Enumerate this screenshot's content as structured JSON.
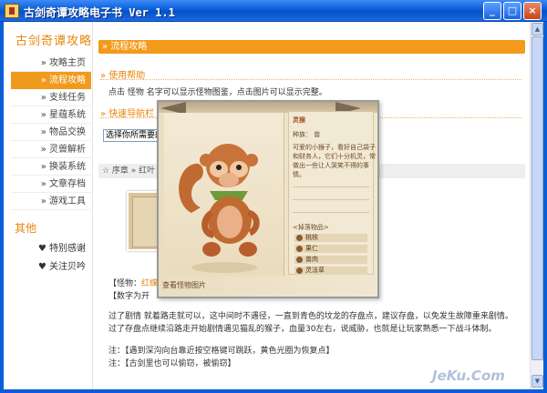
{
  "window": {
    "title": "古剑奇谭攻略电子书 Ver 1.1",
    "minimize": "_",
    "maximize": "□",
    "close": "×"
  },
  "sidebar": {
    "title": "古剑奇谭攻略",
    "items": [
      {
        "label": "» 攻略主页"
      },
      {
        "label": "» 流程攻略"
      },
      {
        "label": "» 支线任务"
      },
      {
        "label": "» 星蕴系统"
      },
      {
        "label": "» 物品交换"
      },
      {
        "label": "» 灵兽解析"
      },
      {
        "label": "» 换装系统"
      },
      {
        "label": "» 文章存档"
      },
      {
        "label": "» 游戏工具"
      }
    ],
    "other_title": "其他",
    "other_items": [
      {
        "label": "♥ 特别感谢"
      },
      {
        "label": "♥ 关注贝吟"
      }
    ]
  },
  "main": {
    "section_title": "» 流程攻略",
    "usage_title": "» 使用帮助",
    "usage_text": "点击 怪物 名字可以显示怪物图鉴，点击图片可以显示完整。",
    "quicknav_title": "» 快速导航栏",
    "chapter_select": "选择你所需要的攻略章节",
    "crumb": "☆ 序章  » 红叶",
    "monster_label": "【怪物：",
    "monster_name": "红蝶",
    "monster_end": "】",
    "number_note": "【数字为开",
    "walk_1": "过了剧情 就着路走就可以，这中间时不遇径，一直到青色的坟龙的存盘点，建议存盘，以免发生故障重来剧情。",
    "walk_2": "过了存盘点继续沿路走开始剧情遇见猫乱的猴子，血量30左右，说威胁，也就是让玩家熟悉一下战斗体制。",
    "note_1": "注：【遇到深沟向台靠近按空格键可跳跃，黄色光圈为恢复点】",
    "note_2": "注：【古剑里也可以偷窃，被偷窃】"
  },
  "popup": {
    "name_label": "灵猴",
    "type_label": "种族：",
    "type_value": "兽",
    "desc_1": "可爱的小猴子，看好自己袋子",
    "desc_2": "和财务人，它们十分机灵，常",
    "desc_3": "做出一些让人哭笑不得的事",
    "desc_4": "情。",
    "drops_title": "<掉落物品>",
    "drops": [
      {
        "label": "桃核"
      },
      {
        "label": "果仁"
      },
      {
        "label": "兽肉"
      },
      {
        "label": "灵法草"
      }
    ],
    "caption": "查看怪物图片"
  },
  "watermark": "JeKu.Com",
  "scroll": {
    "up": "▲",
    "down": "▼"
  },
  "colors": {
    "accent": "#f39a1a",
    "title_bar": "#0a5fd8",
    "heading": "#e8860e"
  }
}
